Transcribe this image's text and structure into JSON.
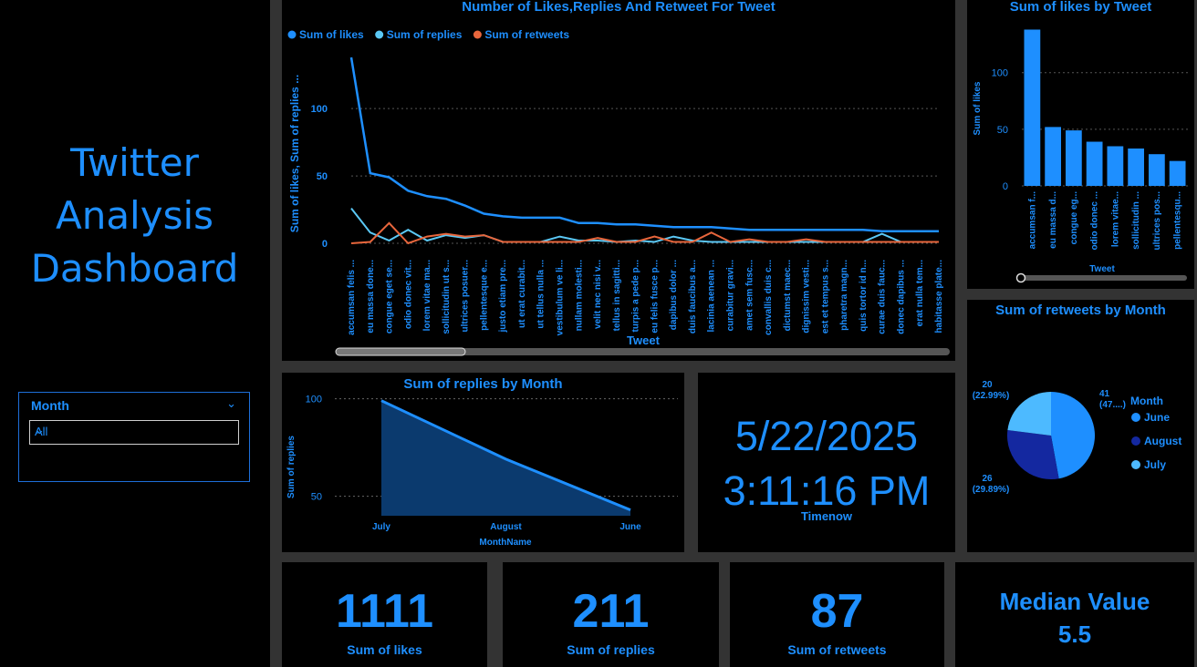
{
  "page_title": "Twitter Analysis Dashboard",
  "title_lines": [
    "Twitter",
    "Analysis",
    "Dashboard"
  ],
  "slicer": {
    "label": "Month",
    "value": "All"
  },
  "line_chart": {
    "title": "Number of Likes,Replies And Retweet For Tweet",
    "legend": [
      "Sum of likes",
      "Sum of replies",
      "Sum of retweets"
    ],
    "xlabel": "Tweet",
    "ylabel": "Sum of likes, Sum of replies ..."
  },
  "bar_chart": {
    "title": "Sum of likes by Tweet",
    "xlabel": "Tweet",
    "ylabel": "Sum of likes"
  },
  "area_chart": {
    "title": "Sum of replies by Month",
    "xlabel": "MonthName",
    "ylabel": "Sum of replies"
  },
  "pie_chart": {
    "title": "Sum of retweets by Month",
    "legend_title": "Month"
  },
  "datetime": {
    "date": "5/22/2025",
    "time": "3:11:16 PM",
    "label": "Timenow"
  },
  "cards": [
    {
      "value": "1111",
      "label": "Sum of likes"
    },
    {
      "value": "211",
      "label": "Sum of replies"
    },
    {
      "value": "87",
      "label": "Sum of retweets"
    }
  ],
  "median": {
    "label": "Median Value",
    "value": "5.5"
  },
  "colors": {
    "accent": "#1e8fff",
    "replies": "#5bc8f5",
    "retweets": "#e8663c",
    "june": "#1e8fff",
    "august": "#1428a0",
    "july": "#4dbaff"
  },
  "chart_data": [
    {
      "type": "line",
      "title": "Number of Likes,Replies And Retweet For Tweet",
      "xlabel": "Tweet",
      "ylabel": "Sum of likes, Sum of replies ...",
      "ylim": [
        0,
        140
      ],
      "yticks": [
        0,
        50,
        100
      ],
      "categories": [
        "accumsan felis ...",
        "eu massa done...",
        "congue eget se...",
        "odio donec vit...",
        "lorem vitae ma...",
        "sollicitudin ut s...",
        "ultrices posuer...",
        "pellentesque e...",
        "justo etiam pre...",
        "ut erat curabit...",
        "ut tellus nulla ...",
        "vestibulum ve li...",
        "nullam molesti...",
        "velit nec nisi v...",
        "tellus in sagitti...",
        "turpis a pede p...",
        "eu felis fusce p...",
        "dapibus dolor ...",
        "duis faucibus a...",
        "lacinia aenean ...",
        "curabitur gravi...",
        "amet sem fusc...",
        "convallis duis c...",
        "dictumst maec...",
        "dignissim vesti...",
        "est et tempus s...",
        "pharetra magn...",
        "quis tortor id n...",
        "curae duis fauc...",
        "donec dapibus ...",
        "erat nulla tem...",
        "habitasse plate..."
      ],
      "series": [
        {
          "name": "Sum of likes",
          "values": [
            138,
            52,
            49,
            39,
            35,
            33,
            28,
            22,
            20,
            19,
            19,
            19,
            15,
            15,
            14,
            14,
            13,
            12,
            12,
            12,
            11,
            10,
            10,
            10,
            10,
            10,
            10,
            10,
            9,
            9,
            9,
            9
          ]
        },
        {
          "name": "Sum of replies",
          "values": [
            26,
            8,
            2,
            10,
            2,
            6,
            4,
            6,
            1,
            1,
            1,
            5,
            2,
            2,
            1,
            2,
            1,
            5,
            2,
            1,
            1,
            1,
            1,
            1,
            1,
            1,
            1,
            1,
            7,
            1,
            1,
            1
          ]
        },
        {
          "name": "Sum of retweets",
          "values": [
            0,
            1,
            15,
            0,
            5,
            7,
            5,
            6,
            1,
            1,
            1,
            1,
            1,
            4,
            1,
            1,
            5,
            1,
            1,
            8,
            1,
            3,
            1,
            1,
            3,
            1,
            1,
            1,
            1,
            1,
            1,
            1
          ]
        }
      ]
    },
    {
      "type": "bar",
      "title": "Sum of likes by Tweet",
      "xlabel": "Tweet",
      "ylabel": "Sum of likes",
      "ylim": [
        0,
        140
      ],
      "yticks": [
        0,
        50,
        100
      ],
      "categories": [
        "accumsan f...",
        "eu massa d...",
        "congue eg...",
        "odio donec ...",
        "lorem vitae...",
        "sollicitudin ...",
        "ultrices pos...",
        "pellentesqu..."
      ],
      "values": [
        138,
        52,
        49,
        39,
        35,
        33,
        28,
        22
      ]
    },
    {
      "type": "area",
      "title": "Sum of replies by Month",
      "xlabel": "MonthName",
      "ylabel": "Sum of replies",
      "categories": [
        "July",
        "August",
        "June"
      ],
      "values": [
        99,
        69,
        43
      ],
      "ylim": [
        40,
        104
      ],
      "yticks": [
        50,
        100
      ]
    },
    {
      "type": "pie",
      "title": "Sum of retweets by Month",
      "legend_title": "Month",
      "categories": [
        "June",
        "August",
        "July"
      ],
      "values": [
        41,
        26,
        20
      ],
      "labels": [
        "41\n(47....)",
        "26\n(29.89%)",
        "20\n(22.99%)"
      ]
    }
  ]
}
